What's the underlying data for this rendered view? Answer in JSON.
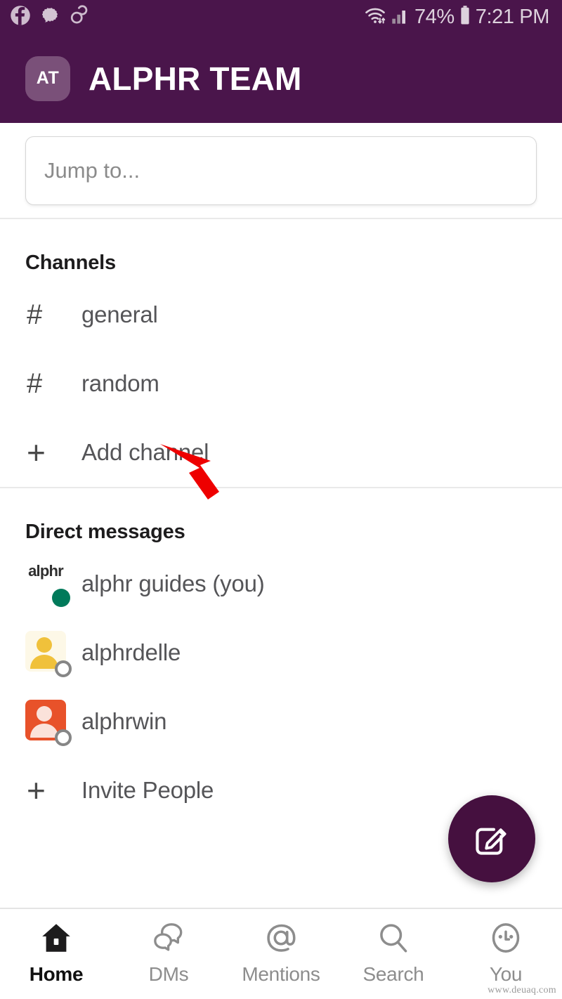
{
  "status_bar": {
    "left_icons": [
      "facebook-icon",
      "message-bubble-icon",
      "ring-link-icon"
    ],
    "wifi_icon": "wifi-data-icon",
    "signal_icon": "cellular-signal-icon",
    "battery_percent": "74%",
    "battery_icon": "battery-icon",
    "time": "7:21 PM"
  },
  "header": {
    "avatar_initials": "AT",
    "workspace_title": "ALPHR TEAM",
    "background_color": "#4a154b",
    "avatar_color": "#7a5079"
  },
  "search": {
    "placeholder": "Jump to...",
    "value": ""
  },
  "channels_section": {
    "title": "Channels",
    "items": [
      {
        "icon": "hash-icon",
        "glyph": "#",
        "label": "general"
      },
      {
        "icon": "hash-icon",
        "glyph": "#",
        "label": "random"
      },
      {
        "icon": "plus-icon",
        "glyph": "+",
        "label": "Add channel"
      }
    ]
  },
  "dms_section": {
    "title": "Direct messages",
    "items": [
      {
        "avatar": "alphr-logo-avatar",
        "avatar_text": "alphr",
        "label": "alphr guides (you)",
        "presence": "online",
        "presence_color": "#007a5a"
      },
      {
        "avatar": "person-avatar-yellow",
        "avatar_text": "",
        "label": "alphrdelle",
        "presence": "offline",
        "presence_color": "#868686"
      },
      {
        "avatar": "person-avatar-orange",
        "avatar_text": "",
        "label": "alphrwin",
        "presence": "offline",
        "presence_color": "#868686"
      }
    ],
    "invite": {
      "icon": "plus-icon",
      "glyph": "+",
      "label": "Invite People"
    }
  },
  "fab": {
    "icon": "compose-icon",
    "color": "#45103f"
  },
  "annotation": {
    "arrow_color": "#ee0000",
    "points_at": "random"
  },
  "bottom_nav": {
    "items": [
      {
        "icon": "home-icon",
        "label": "Home",
        "active": true
      },
      {
        "icon": "dms-bubbles-icon",
        "label": "DMs",
        "active": false
      },
      {
        "icon": "at-mention-icon",
        "label": "Mentions",
        "active": false
      },
      {
        "icon": "search-magnifier-icon",
        "label": "Search",
        "active": false
      },
      {
        "icon": "you-face-icon",
        "label": "You",
        "active": false
      }
    ]
  },
  "watermark": "www.deuaq.com"
}
